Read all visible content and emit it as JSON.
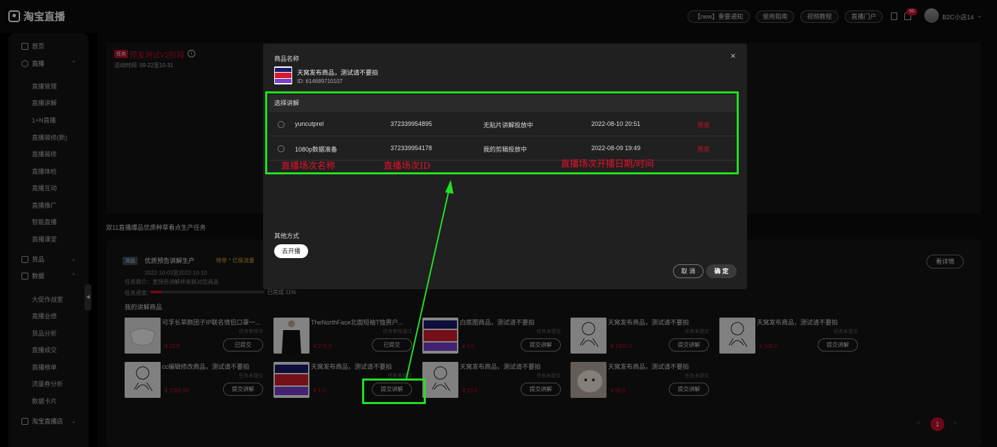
{
  "topbar": {
    "logo": "淘宝直播",
    "buttons": [
      "【new】重要通知",
      "使用指南",
      "视频教程",
      "直播门户"
    ],
    "badge_count": "96",
    "user": "B2C小店14"
  },
  "sidebar": {
    "home": "首页",
    "live": "直播",
    "live_sub": [
      "直播管理",
      "直播讲解",
      "1+N直播",
      "直播装修(新)",
      "直播装修",
      "直播体检",
      "直播互动",
      "直播推广",
      "智能直播",
      "直播课堂"
    ],
    "goods": "货品",
    "data": "数据",
    "data_sub": [
      "大促作战室",
      "直播业绩",
      "货品分析",
      "直播成交",
      "直播榜单",
      "流量券分析",
      "数据卡片"
    ],
    "store": "淘宝直播店"
  },
  "card1": {
    "tag": "任务",
    "title": "预发测试V2阶段",
    "time": "活动时间: 09-22至10-31"
  },
  "section_title": "双11直播爆品优质种草看点生产任务",
  "task": {
    "tag": "货品",
    "title": "优质预告讲解生产",
    "highlight": "榜单 * 亿级流量",
    "date": "2022-10-03至2022-10-10",
    "desc": "任务简介：里预告讲解并关联对应商品",
    "progress_label": "任务进度：",
    "progress_pct": 11,
    "progress_text": "已完成 11%",
    "detail_btn": "看详情",
    "my_products": "我的讲解商品"
  },
  "products": [
    {
      "name": "可孚长草颜团子IP联名情侣口罩一...",
      "status": "任务审核中",
      "price": "￥29.9",
      "button": "已提交",
      "thumb": "mask"
    },
    {
      "name": "TheNorthFace北面短袖T恤男户...",
      "status": "任务审核通过",
      "price": "￥278.0",
      "button": "已提交",
      "thumb": "shirt"
    },
    {
      "name": "白底图商品，测试请不要拍",
      "status": "任务未提交",
      "price": "￥1.0",
      "button": "提交讲解",
      "thumb": "promo"
    },
    {
      "name": "天窝发布商品，测试请不要拍",
      "status": "任务未提交",
      "price": "￥1000.0",
      "button": "提交讲解",
      "thumb": "sketch"
    },
    {
      "name": "天窝发布商品，测试请不要拍",
      "status": "任务未提交",
      "price": "￥100.0",
      "button": "提交讲解",
      "thumb": "sketch"
    },
    {
      "name": "cc编辑修改商品，测试请不要拍",
      "status": "任务未提交",
      "price": "￥1588.56",
      "button": "提交讲解",
      "thumb": "sketch"
    },
    {
      "name": "天窝发布商品，测试请不要拍",
      "status": "任务未提交",
      "price": "￥1.0",
      "button": "提交讲解",
      "thumb": "promo"
    },
    {
      "name": "天窝发布商品，测试请不要拍",
      "status": "任务未提交",
      "price": "￥10.0",
      "button": "提交讲解",
      "thumb": "sketch"
    },
    {
      "name": "天窝发布商品，测试请不要拍",
      "status": "任务未提交",
      "price": "￥99.0",
      "button": "提交讲解",
      "thumb": "cat"
    }
  ],
  "pager": {
    "current": "1",
    "prev": "<",
    "next": ">"
  },
  "modal": {
    "product_label": "商品名称",
    "product_name": "天窝发布商品，测试请不要拍",
    "product_id": "ID: 614689710107",
    "select_label": "选择讲解",
    "rows": [
      {
        "name": "yuncutprel",
        "id": "372339954895",
        "status": "无贴片讲解投放中",
        "time": "2022-08-10 20:51",
        "action": "预览"
      },
      {
        "name": "1080p数据准备",
        "id": "372339954178",
        "status": "我的剪辑投放中",
        "time": "2022-08-09 19:49",
        "action": "预览"
      }
    ],
    "other_ways": "其他方式",
    "go_live": "去开播",
    "cancel": "取 消",
    "confirm": "确 定",
    "close": "×"
  },
  "annotations": {
    "name": "直播场次名称",
    "id": "直播场次ID",
    "time": "直播场次开播日期/时间",
    "color_highlight": "#22e022",
    "color_text": "#e8102a"
  }
}
